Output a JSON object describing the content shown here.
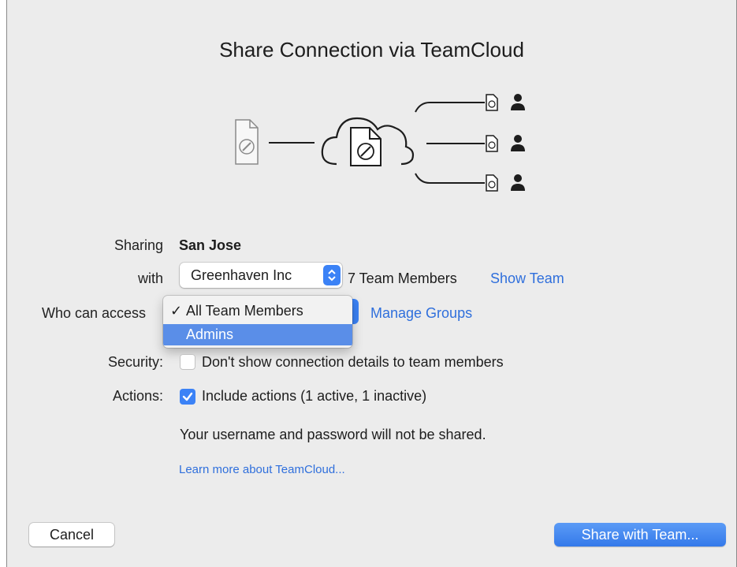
{
  "dialog": {
    "title": "Share Connection via TeamCloud",
    "sharing_label": "Sharing",
    "sharing_value": "San Jose",
    "with_label": "with",
    "team_select_value": "Greenhaven Inc",
    "team_members_count": "7 Team Members",
    "show_team_link": "Show Team",
    "access_label": "Who can access",
    "manage_groups_link": "Manage Groups",
    "access_menu": {
      "options": [
        {
          "label": "All Team Members",
          "checked": "✓"
        },
        {
          "label": "Admins"
        }
      ],
      "highlighted_index": 1
    },
    "security_label": "Security:",
    "security_checkbox_label": "Don't show connection details to team members",
    "actions_label": "Actions:",
    "actions_checkbox_label": "Include actions (1 active, 1 inactive)",
    "credentials_note": "Your username and password will not be shared.",
    "learn_more_link": "Learn more about TeamCloud...",
    "cancel_button": "Cancel",
    "share_button": "Share with Team..."
  },
  "checkboxes": {
    "security_checked": false,
    "actions_checked": true
  },
  "icons": [
    "connection-file-icon",
    "cloud-icon",
    "user-icon"
  ],
  "colors": {
    "accent": "#3b82f6",
    "link": "#2f6fdc",
    "background": "#ececec"
  }
}
